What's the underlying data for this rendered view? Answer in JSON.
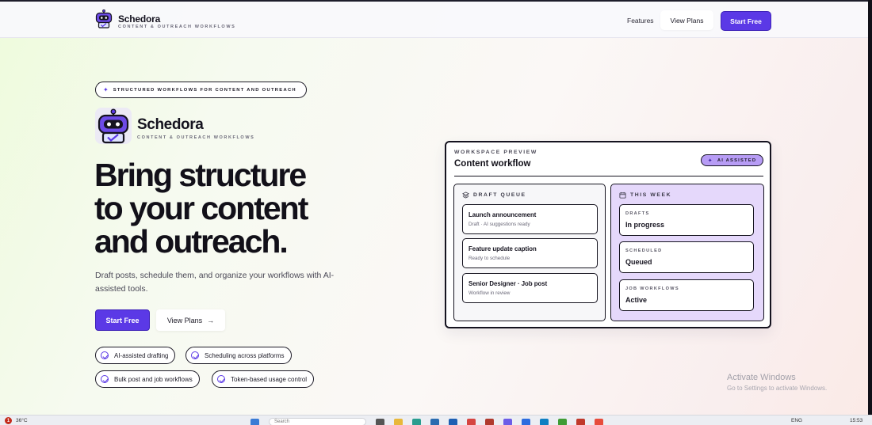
{
  "header": {
    "brand_name": "Schedora",
    "brand_tagline": "CONTENT & OUTREACH WORKFLOWS",
    "nav_features": "Features",
    "nav_view_plans": "View Plans",
    "nav_start_free": "Start Free"
  },
  "hero": {
    "badge": "STRUCTURED WORKFLOWS FOR CONTENT AND OUTREACH",
    "brand_name": "Schedora",
    "brand_tagline": "CONTENT & OUTREACH WORKFLOWS",
    "headline_lines": [
      "Bring structure",
      "to your content",
      "and outreach."
    ],
    "subtitle": "Draft posts, schedule them, and organize your workflows with AI-assisted tools.",
    "cta_primary": "Start Free",
    "cta_secondary": "View Plans",
    "cta_secondary_icon": "arrow-right-icon",
    "features": [
      "AI-assisted drafting",
      "Scheduling across platforms",
      "Bulk post and job workflows",
      "Token-based usage control"
    ]
  },
  "preview": {
    "kicker": "WORKSPACE PREVIEW",
    "title": "Content workflow",
    "badge": "AI ASSISTED",
    "draft_queue": {
      "heading": "DRAFT QUEUE",
      "items": [
        {
          "title": "Launch announcement",
          "subtitle": "Draft · AI suggestions ready"
        },
        {
          "title": "Feature update caption",
          "subtitle": "Ready to schedule"
        },
        {
          "title": "Senior Designer · Job post",
          "subtitle": "Workflow in review"
        }
      ]
    },
    "this_week": {
      "heading": "THIS WEEK",
      "stats": [
        {
          "label": "DRAFTS",
          "value": "In progress"
        },
        {
          "label": "SCHEDULED",
          "value": "Queued"
        },
        {
          "label": "JOB WORKFLOWS",
          "value": "Active"
        }
      ]
    }
  },
  "watermark": {
    "line1": "Activate Windows",
    "line2": "Go to Settings to activate Windows."
  },
  "taskbar": {
    "weather_badge": "1",
    "temperature": "36°C",
    "search_placeholder": "Search",
    "language": "ENG",
    "time": "15:53"
  },
  "colors": {
    "accent": "#5b39e6",
    "accent_light": "#b79cf5",
    "week_panel": "#e5d8fb",
    "ink": "#15131f"
  }
}
